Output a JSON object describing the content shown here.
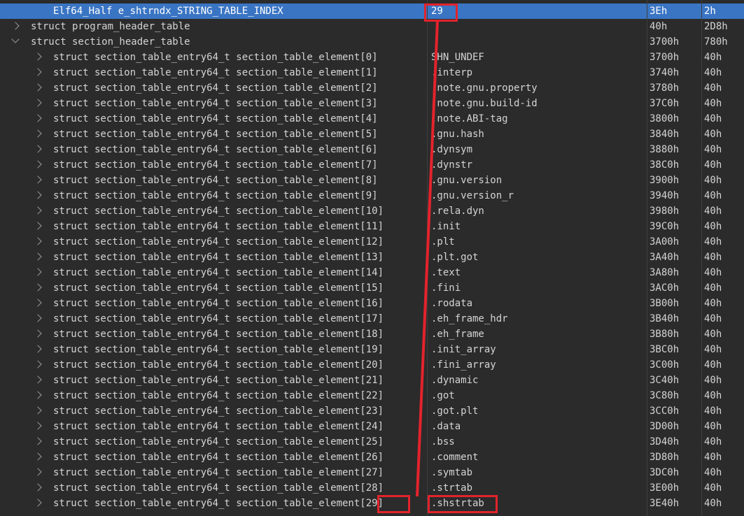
{
  "selected_row": {
    "name": "Elf64_Half e_shtrndx_STRING_TABLE_INDEX",
    "value": "29",
    "start": "3Eh",
    "size": "2h"
  },
  "top_rows": [
    {
      "name": "struct program_header_table",
      "value": "",
      "start": "40h",
      "size": "2D8h",
      "expanded": false
    },
    {
      "name": "struct section_header_table",
      "value": "",
      "start": "3700h",
      "size": "780h",
      "expanded": true
    }
  ],
  "section_entries": [
    {
      "name": "struct section_table_entry64_t section_table_element[0]",
      "value": "SHN_UNDEF",
      "start": "3700h",
      "size": "40h"
    },
    {
      "name": "struct section_table_entry64_t section_table_element[1]",
      "value": ".interp",
      "start": "3740h",
      "size": "40h"
    },
    {
      "name": "struct section_table_entry64_t section_table_element[2]",
      "value": ".note.gnu.property",
      "start": "3780h",
      "size": "40h"
    },
    {
      "name": "struct section_table_entry64_t section_table_element[3]",
      "value": ".note.gnu.build-id",
      "start": "37C0h",
      "size": "40h"
    },
    {
      "name": "struct section_table_entry64_t section_table_element[4]",
      "value": ".note.ABI-tag",
      "start": "3800h",
      "size": "40h"
    },
    {
      "name": "struct section_table_entry64_t section_table_element[5]",
      "value": ".gnu.hash",
      "start": "3840h",
      "size": "40h"
    },
    {
      "name": "struct section_table_entry64_t section_table_element[6]",
      "value": ".dynsym",
      "start": "3880h",
      "size": "40h"
    },
    {
      "name": "struct section_table_entry64_t section_table_element[7]",
      "value": ".dynstr",
      "start": "38C0h",
      "size": "40h"
    },
    {
      "name": "struct section_table_entry64_t section_table_element[8]",
      "value": ".gnu.version",
      "start": "3900h",
      "size": "40h"
    },
    {
      "name": "struct section_table_entry64_t section_table_element[9]",
      "value": ".gnu.version_r",
      "start": "3940h",
      "size": "40h"
    },
    {
      "name": "struct section_table_entry64_t section_table_element[10]",
      "value": ".rela.dyn",
      "start": "3980h",
      "size": "40h"
    },
    {
      "name": "struct section_table_entry64_t section_table_element[11]",
      "value": ".init",
      "start": "39C0h",
      "size": "40h"
    },
    {
      "name": "struct section_table_entry64_t section_table_element[12]",
      "value": ".plt",
      "start": "3A00h",
      "size": "40h"
    },
    {
      "name": "struct section_table_entry64_t section_table_element[13]",
      "value": ".plt.got",
      "start": "3A40h",
      "size": "40h"
    },
    {
      "name": "struct section_table_entry64_t section_table_element[14]",
      "value": ".text",
      "start": "3A80h",
      "size": "40h"
    },
    {
      "name": "struct section_table_entry64_t section_table_element[15]",
      "value": ".fini",
      "start": "3AC0h",
      "size": "40h"
    },
    {
      "name": "struct section_table_entry64_t section_table_element[16]",
      "value": ".rodata",
      "start": "3B00h",
      "size": "40h"
    },
    {
      "name": "struct section_table_entry64_t section_table_element[17]",
      "value": ".eh_frame_hdr",
      "start": "3B40h",
      "size": "40h"
    },
    {
      "name": "struct section_table_entry64_t section_table_element[18]",
      "value": ".eh_frame",
      "start": "3B80h",
      "size": "40h"
    },
    {
      "name": "struct section_table_entry64_t section_table_element[19]",
      "value": ".init_array",
      "start": "3BC0h",
      "size": "40h"
    },
    {
      "name": "struct section_table_entry64_t section_table_element[20]",
      "value": ".fini_array",
      "start": "3C00h",
      "size": "40h"
    },
    {
      "name": "struct section_table_entry64_t section_table_element[21]",
      "value": ".dynamic",
      "start": "3C40h",
      "size": "40h"
    },
    {
      "name": "struct section_table_entry64_t section_table_element[22]",
      "value": ".got",
      "start": "3C80h",
      "size": "40h"
    },
    {
      "name": "struct section_table_entry64_t section_table_element[23]",
      "value": ".got.plt",
      "start": "3CC0h",
      "size": "40h"
    },
    {
      "name": "struct section_table_entry64_t section_table_element[24]",
      "value": ".data",
      "start": "3D00h",
      "size": "40h"
    },
    {
      "name": "struct section_table_entry64_t section_table_element[25]",
      "value": ".bss",
      "start": "3D40h",
      "size": "40h"
    },
    {
      "name": "struct section_table_entry64_t section_table_element[26]",
      "value": ".comment",
      "start": "3D80h",
      "size": "40h"
    },
    {
      "name": "struct section_table_entry64_t section_table_element[27]",
      "value": ".symtab",
      "start": "3DC0h",
      "size": "40h"
    },
    {
      "name": "struct section_table_entry64_t section_table_element[28]",
      "value": ".strtab",
      "start": "3E00h",
      "size": "40h"
    },
    {
      "name": "struct section_table_entry64_t section_table_element[29]",
      "value": ".shstrtab",
      "start": "3E40h",
      "size": "40h"
    }
  ],
  "colors": {
    "background": "#2b2b2b",
    "text": "#d4d4d4",
    "selection": "#3a75c4",
    "annotation": "#e3232c"
  },
  "icons": {
    "collapsed": "chevron-right-icon",
    "expanded": "chevron-down-icon"
  }
}
